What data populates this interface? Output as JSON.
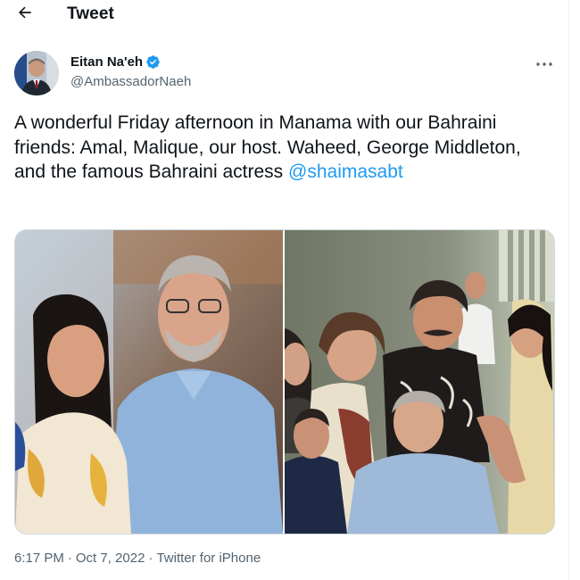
{
  "header": {
    "back_icon": "arrow-left-icon",
    "title": "Tweet"
  },
  "author": {
    "name": "Eitan Na'eh",
    "handle": "@AmbassadorNaeh",
    "verified_icon": "verified-badge-icon",
    "more_icon": "more-horizontal-icon"
  },
  "tweet": {
    "text": "A wonderful Friday afternoon in Manama with our Bahraini friends: Amal, Malique, our host. Waheed, George Middleton, and the famous Bahraini actress ",
    "mention": "@shaimasabt",
    "time": "6:17 PM",
    "separator": "·",
    "date": "Oct 7, 2022",
    "source": "Twitter for iPhone"
  },
  "colors": {
    "accent": "#1d9bf0",
    "secondary_text": "#536471",
    "primary_text": "#0f1419"
  }
}
